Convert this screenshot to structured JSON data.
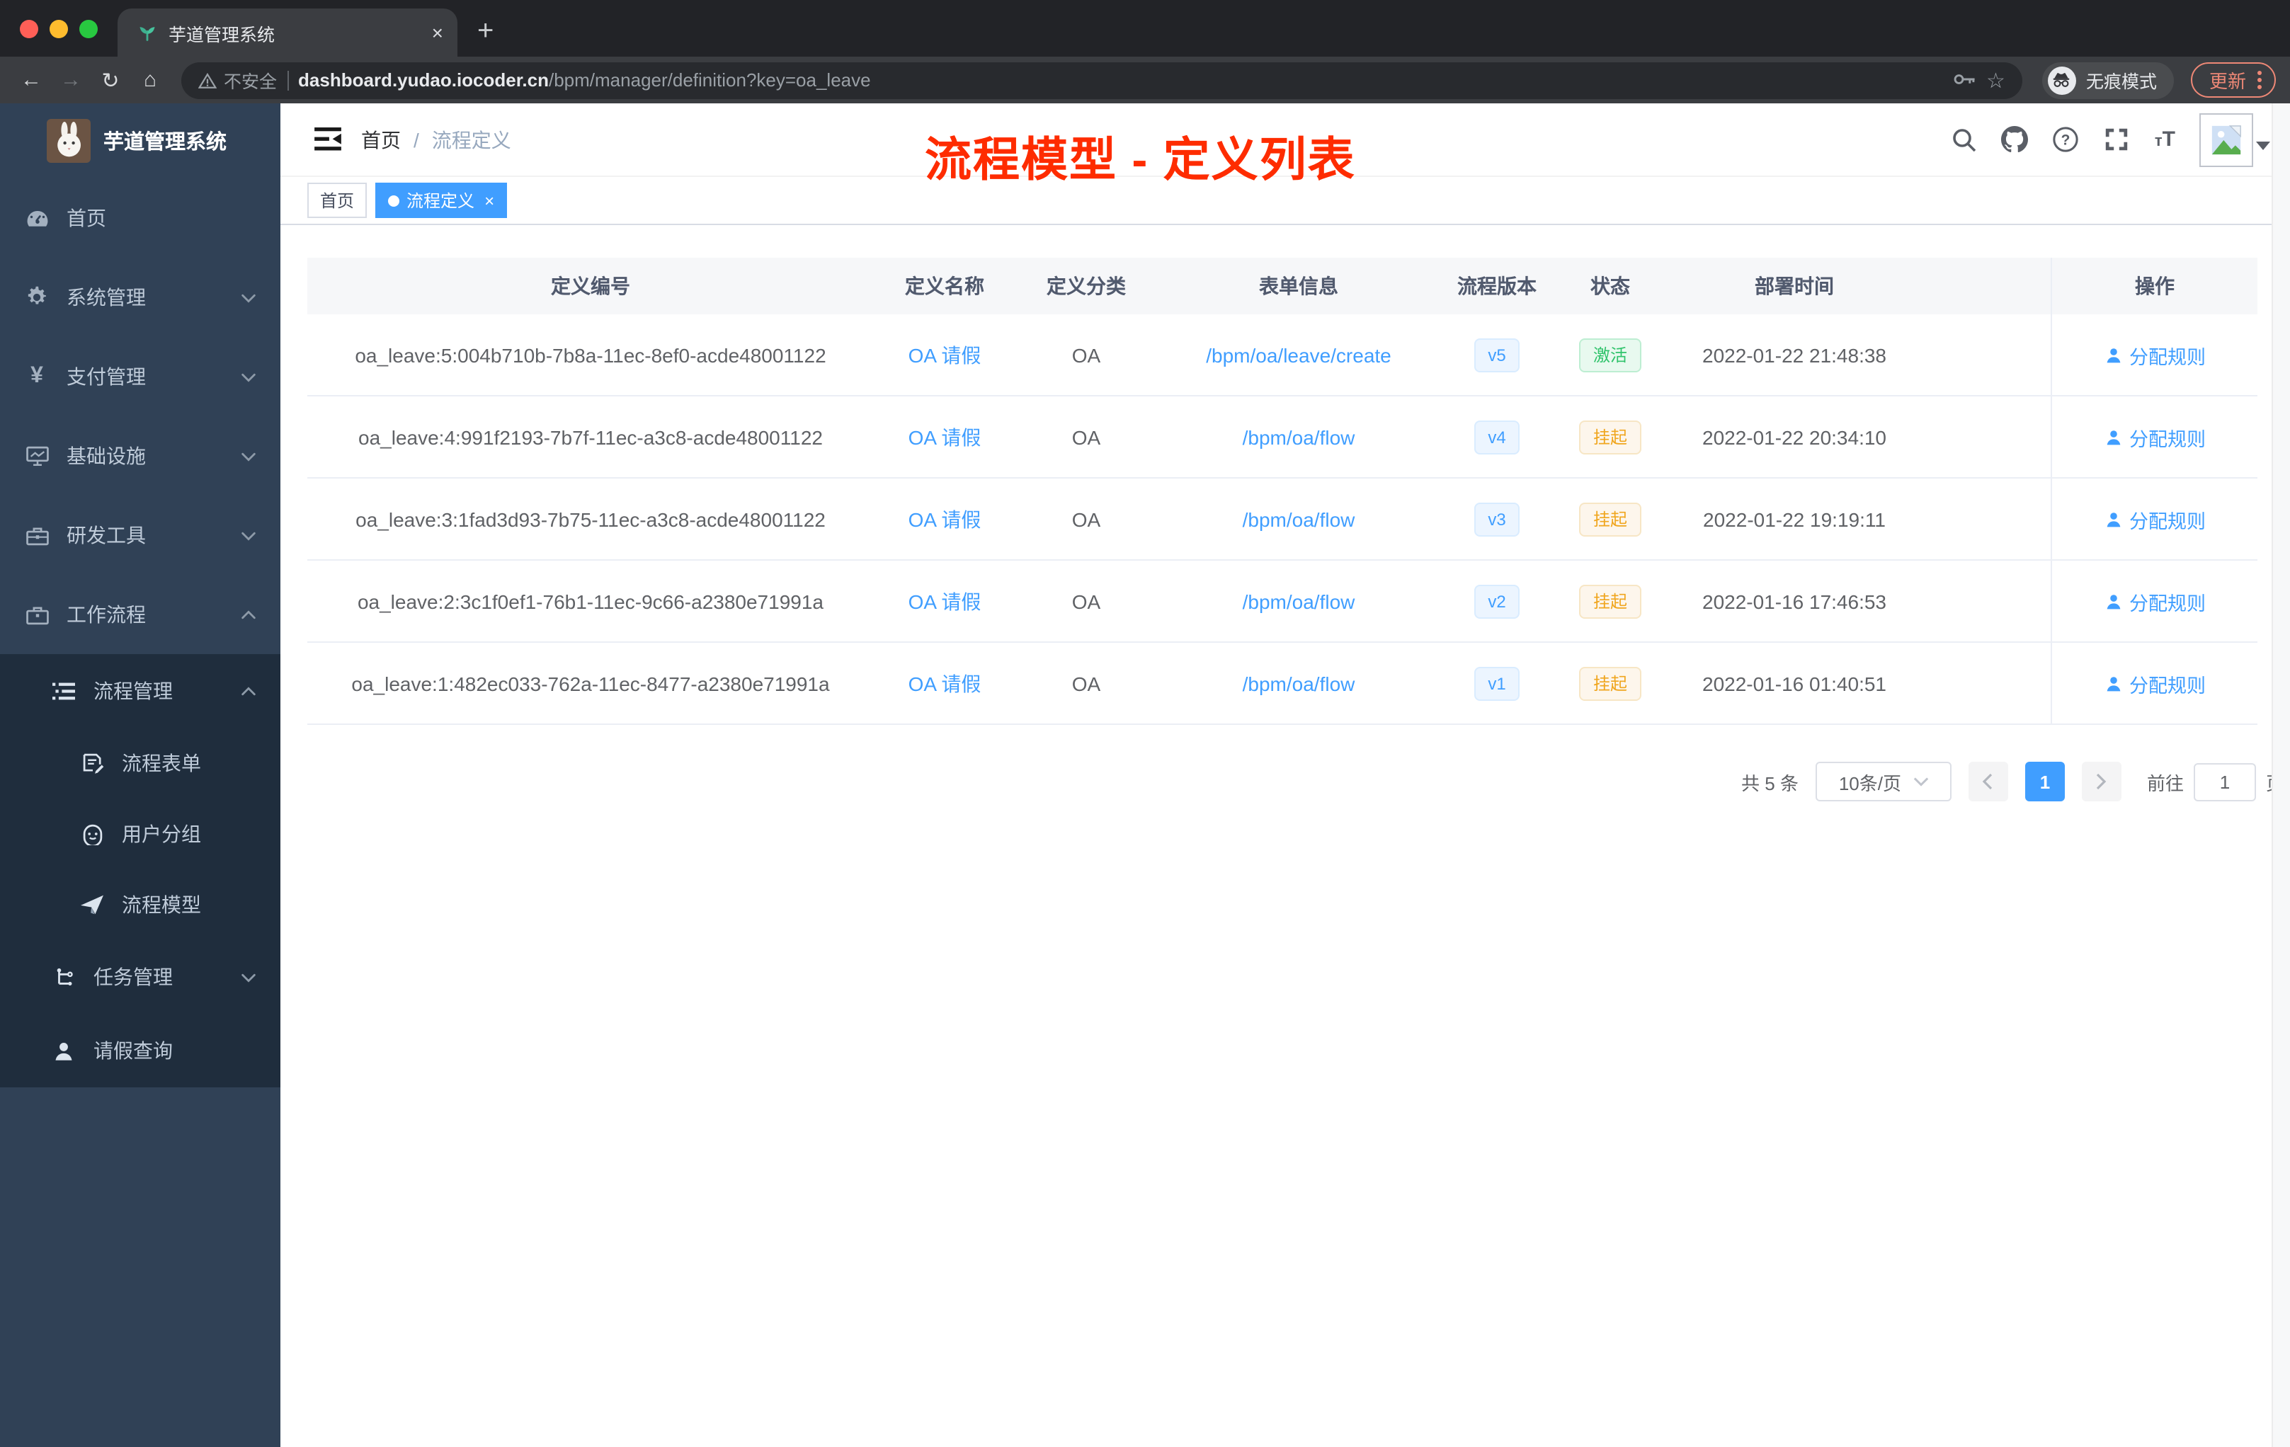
{
  "browser": {
    "tab": {
      "title": "芋道管理系统",
      "close": "×",
      "new_tab": "+"
    },
    "security_label": "不安全",
    "url_host": "dashboard.yudao.iocoder.cn",
    "url_path": "/bpm/manager/definition?key=oa_leave",
    "incognito_label": "无痕模式",
    "update_label": "更新"
  },
  "annotation": {
    "text": "流程模型 - 定义列表",
    "color": "#fe2c00"
  },
  "sidebar": {
    "app_title": "芋道管理系统",
    "items": [
      {
        "label": "首页",
        "icon": "dashboard-icon",
        "level": 0,
        "sub": false,
        "chevron": null
      },
      {
        "label": "系统管理",
        "icon": "gear-icon",
        "level": 0,
        "sub": false,
        "chevron": "down"
      },
      {
        "label": "支付管理",
        "icon": "yen-icon",
        "level": 0,
        "sub": false,
        "chevron": "down"
      },
      {
        "label": "基础设施",
        "icon": "monitor-icon",
        "level": 0,
        "sub": false,
        "chevron": "down"
      },
      {
        "label": "研发工具",
        "icon": "toolbox-icon",
        "level": 0,
        "sub": false,
        "chevron": "down"
      },
      {
        "label": "工作流程",
        "icon": "briefcase-icon",
        "level": 0,
        "sub": false,
        "chevron": "up"
      },
      {
        "label": "流程管理",
        "icon": "list-tree-icon",
        "level": 1,
        "sub": true,
        "chevron": "up"
      },
      {
        "label": "流程表单",
        "icon": "form-doc-icon",
        "level": 2,
        "sub": true,
        "chevron": null
      },
      {
        "label": "用户分组",
        "icon": "user-group-icon",
        "level": 2,
        "sub": true,
        "chevron": null
      },
      {
        "label": "流程模型",
        "icon": "paper-plane-icon",
        "level": 2,
        "sub": true,
        "chevron": null
      },
      {
        "label": "任务管理",
        "icon": "task-tree-icon",
        "level": 1,
        "sub": true,
        "chevron": "down"
      },
      {
        "label": "请假查询",
        "icon": "person-icon",
        "level": 1,
        "sub": true,
        "chevron": null
      }
    ]
  },
  "header": {
    "breadcrumb": {
      "home": "首页",
      "separator": "/",
      "current": "流程定义"
    }
  },
  "tags": [
    {
      "label": "首页",
      "active": false,
      "closable": false
    },
    {
      "label": "流程定义",
      "active": true,
      "closable": true
    }
  ],
  "table": {
    "columns": [
      "定义编号",
      "定义名称",
      "定义分类",
      "表单信息",
      "流程版本",
      "状态",
      "部署时间",
      "操作"
    ],
    "rows": [
      {
        "id": "oa_leave:5:004b710b-7b8a-11ec-8ef0-acde48001122",
        "name": "OA 请假",
        "category": "OA",
        "form": "/bpm/oa/leave/create",
        "version": "v5",
        "status": "激活",
        "status_type": "active",
        "deployed_at": "2022-01-22 21:48:38",
        "action": "分配规则"
      },
      {
        "id": "oa_leave:4:991f2193-7b7f-11ec-a3c8-acde48001122",
        "name": "OA 请假",
        "category": "OA",
        "form": "/bpm/oa/flow",
        "version": "v4",
        "status": "挂起",
        "status_type": "suspended",
        "deployed_at": "2022-01-22 20:34:10",
        "action": "分配规则"
      },
      {
        "id": "oa_leave:3:1fad3d93-7b75-11ec-a3c8-acde48001122",
        "name": "OA 请假",
        "category": "OA",
        "form": "/bpm/oa/flow",
        "version": "v3",
        "status": "挂起",
        "status_type": "suspended",
        "deployed_at": "2022-01-22 19:19:11",
        "action": "分配规则"
      },
      {
        "id": "oa_leave:2:3c1f0ef1-76b1-11ec-9c66-a2380e71991a",
        "name": "OA 请假",
        "category": "OA",
        "form": "/bpm/oa/flow",
        "version": "v2",
        "status": "挂起",
        "status_type": "suspended",
        "deployed_at": "2022-01-16 17:46:53",
        "action": "分配规则"
      },
      {
        "id": "oa_leave:1:482ec033-762a-11ec-8477-a2380e71991a",
        "name": "OA 请假",
        "category": "OA",
        "form": "/bpm/oa/flow",
        "version": "v1",
        "status": "挂起",
        "status_type": "suspended",
        "deployed_at": "2022-01-16 01:40:51",
        "action": "分配规则"
      }
    ]
  },
  "pagination": {
    "total": "共 5 条",
    "page_size": "10条/页",
    "current": "1",
    "goto_label": "前往",
    "goto_value": "1",
    "unit_label": "页"
  },
  "colors": {
    "accent": "#409eff",
    "annotation_red": "#fe2c00",
    "active_green": "#2fc36b",
    "suspended_amber": "#f0a61f"
  }
}
